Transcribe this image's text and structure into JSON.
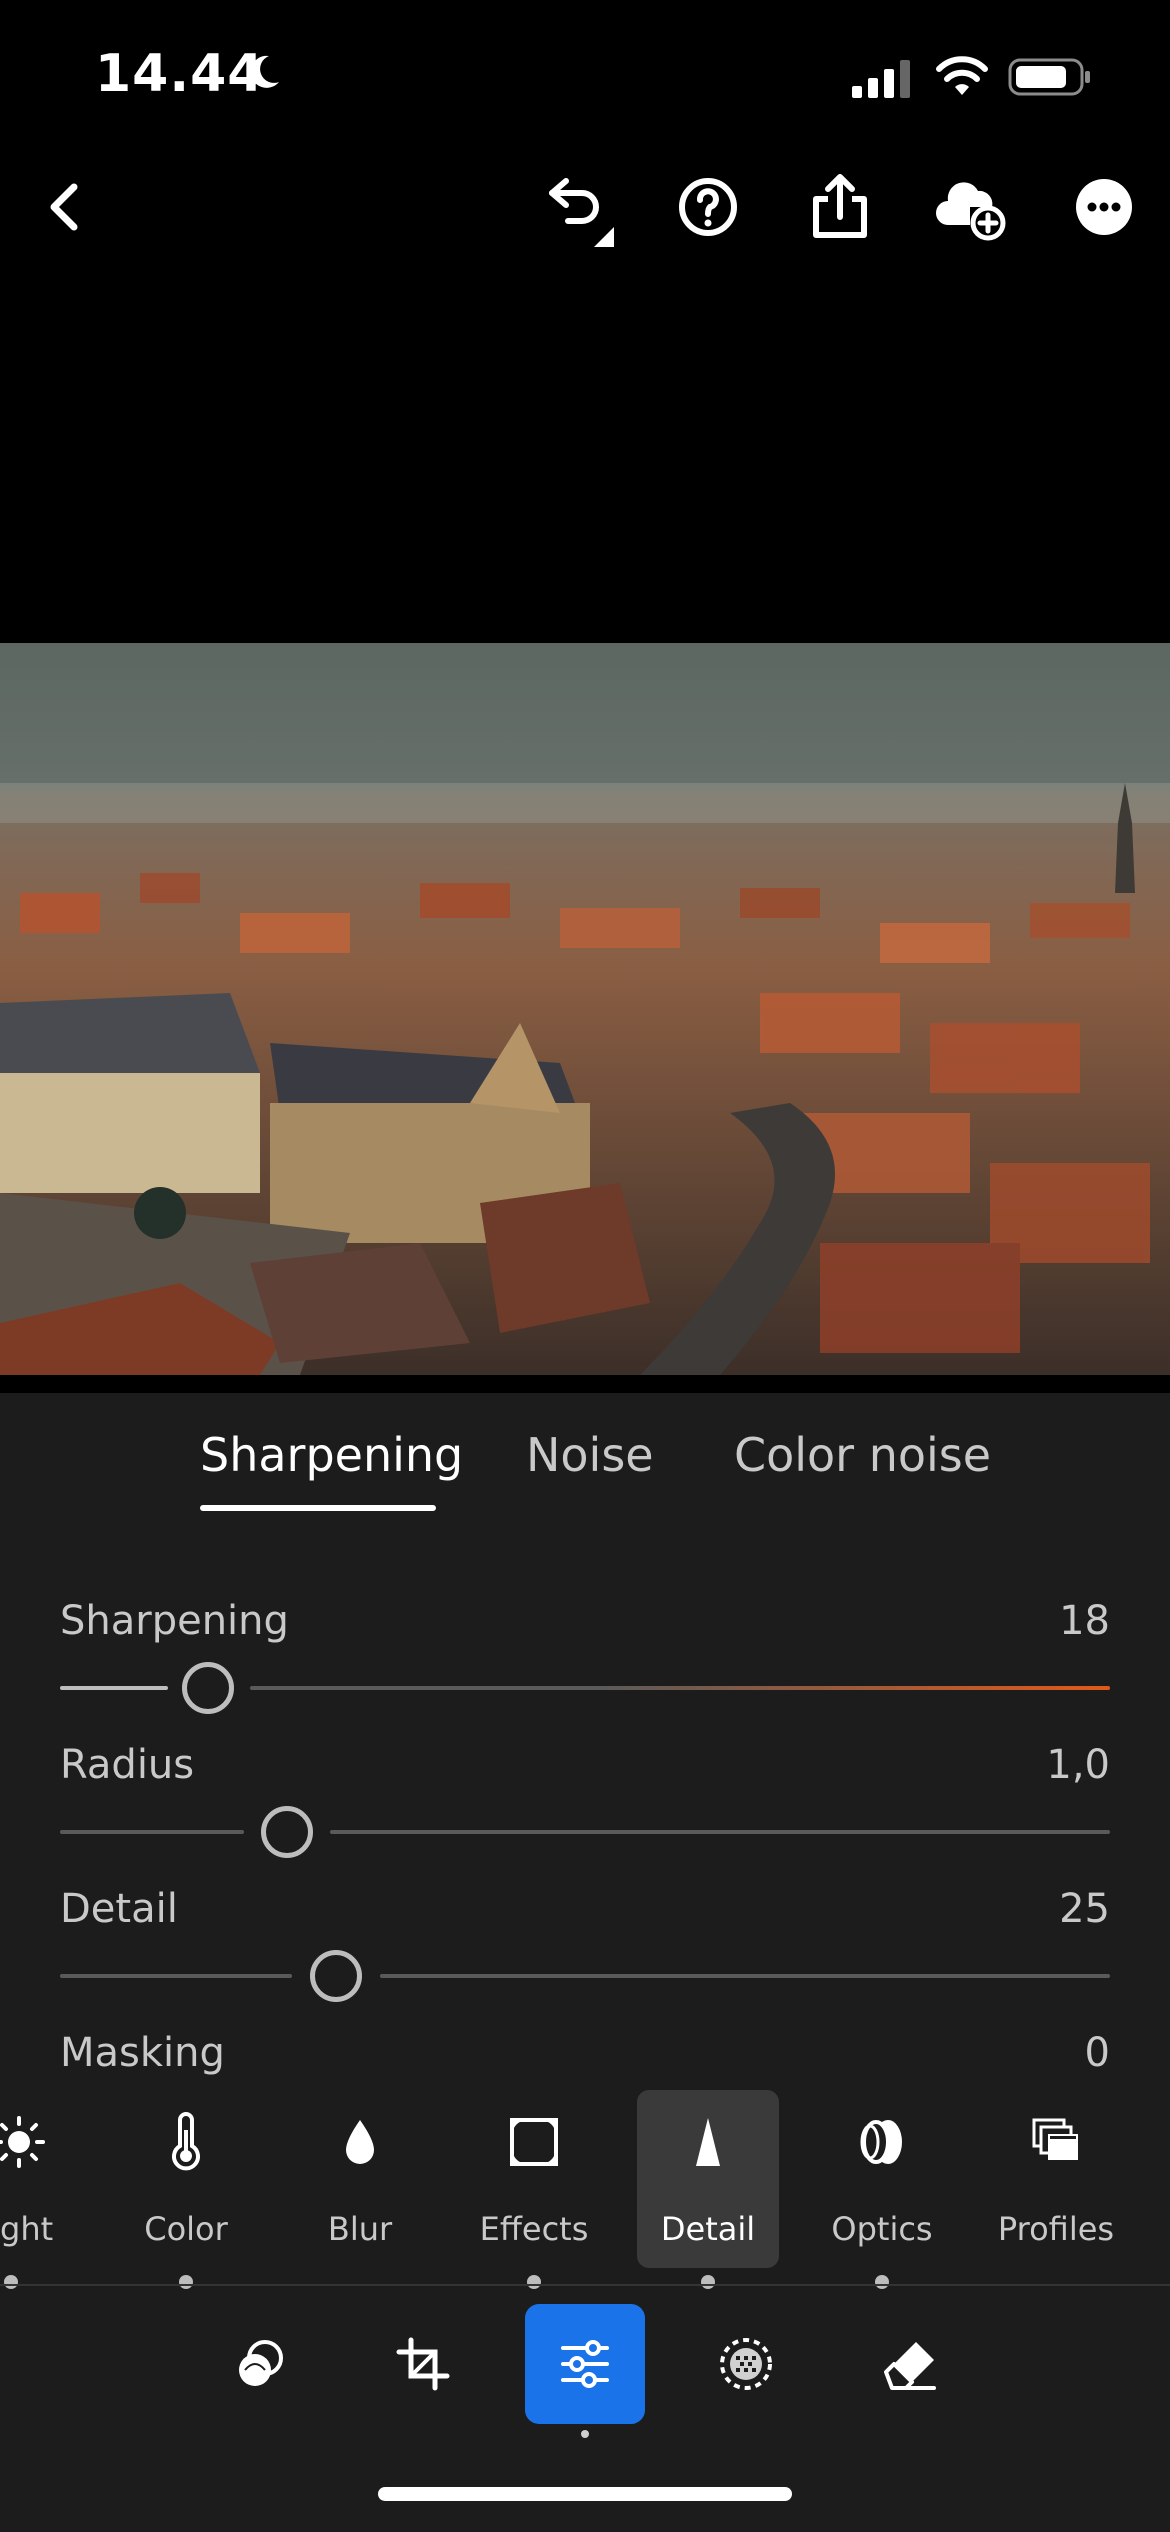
{
  "status_bar": {
    "time": "14.44"
  },
  "top_bar": {
    "icons": [
      "back-icon",
      "undo-icon",
      "help-icon",
      "share-icon",
      "cloud-add-icon",
      "more-icon"
    ]
  },
  "detail_tabs": [
    {
      "label": "Sharpening",
      "active": true
    },
    {
      "label": "Noise",
      "active": false
    },
    {
      "label": "Color noise",
      "active": false
    }
  ],
  "sliders": [
    {
      "label": "Sharpening",
      "value": "18"
    },
    {
      "label": "Radius",
      "value": "1,0"
    },
    {
      "label": "Detail",
      "value": "25"
    },
    {
      "label": "Masking",
      "value": "0"
    }
  ],
  "tools": [
    {
      "label": "ght",
      "icon": "light-icon"
    },
    {
      "label": "Color",
      "icon": "thermometer-icon"
    },
    {
      "label": "Blur",
      "icon": "drop-icon"
    },
    {
      "label": "Effects",
      "icon": "vignette-icon"
    },
    {
      "label": "Detail",
      "icon": "triangle-icon",
      "active": true
    },
    {
      "label": "Optics",
      "icon": "lens-icon"
    },
    {
      "label": "Profiles",
      "icon": "profiles-icon"
    }
  ],
  "bottom_nav": [
    "presets-icon",
    "crop-icon",
    "edit-sliders-icon",
    "masking-icon",
    "healing-icon"
  ],
  "colors": {
    "accent": "#1a73e8",
    "sharpen_gradient_end": "#e05a1a"
  }
}
